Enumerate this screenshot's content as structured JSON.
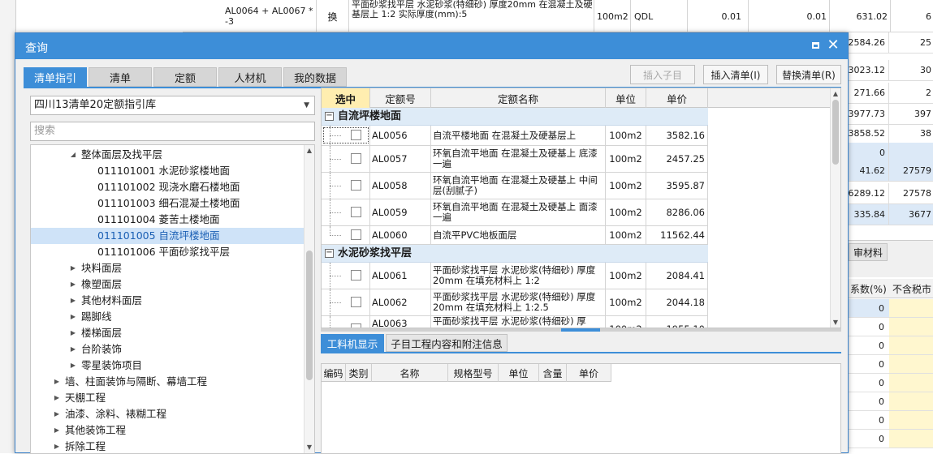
{
  "background": {
    "top_row": {
      "code": "AL0064 + AL0067 * -3",
      "type": "换",
      "desc": "平面砂浆找平层 水泥砂浆(特细砂) 厚度20mm 在混凝土及硬基层上 1:2  实际厚度(mm):5",
      "unit": "100m2",
      "qty_expr": "QDL",
      "qty1": "0.01",
      "qty2": "0.01",
      "price": "631.02",
      "extra": "6"
    },
    "right_values": [
      {
        "a": "2584.26",
        "b": "25"
      },
      {
        "a": "3023.12",
        "b": "30"
      },
      {
        "a": "271.66",
        "b": "2"
      },
      {
        "a": "3977.73",
        "b": "397"
      },
      {
        "a": "3858.52",
        "b": "38"
      },
      {
        "a": "0",
        "b": ""
      },
      {
        "a": "41.62",
        "b": "27579"
      },
      {
        "a": "6289.12",
        "b": "27578"
      },
      {
        "a": "335.84",
        "b": "3677"
      }
    ],
    "right_tab": "审材料",
    "right_header_a": "系数(%)",
    "right_header_b": "不含税市",
    "right_zero_rows": [
      "0",
      "0",
      "0",
      "0",
      "0",
      "0",
      "0",
      "0"
    ]
  },
  "dialog": {
    "title": "查询",
    "tabs": [
      "清单指引",
      "清单",
      "定额",
      "人材机",
      "我的数据"
    ],
    "buttons": {
      "insert_sub": "插入子目",
      "insert_list": "插入清单(I)",
      "replace_list": "替换清单(R)"
    },
    "library": "四川13清单20定额指引库",
    "search_placeholder": "搜索",
    "tree": [
      {
        "label": "整体面层及找平层",
        "expanded": true
      },
      {
        "label": "011101001  水泥砂浆楼地面"
      },
      {
        "label": "011101002  现浇水磨石楼地面"
      },
      {
        "label": "011101003  细石混凝土楼地面"
      },
      {
        "label": "011101004  菱苦土楼地面"
      },
      {
        "label": "011101005  自流坪楼地面"
      },
      {
        "label": "011101006  平面砂浆找平层"
      },
      {
        "label": "块料面层"
      },
      {
        "label": "橡塑面层"
      },
      {
        "label": "其他材料面层"
      },
      {
        "label": "踢脚线"
      },
      {
        "label": "楼梯面层"
      },
      {
        "label": "台阶装饰"
      },
      {
        "label": "零星装饰项目"
      },
      {
        "label": "墙、柱面装饰与隔断、幕墙工程"
      },
      {
        "label": "天棚工程"
      },
      {
        "label": "油漆、涂料、裱糊工程"
      },
      {
        "label": "其他装饰工程"
      },
      {
        "label": "拆除工程"
      }
    ],
    "grid": {
      "headers": [
        "选中",
        "定额号",
        "定额名称",
        "单位",
        "单价"
      ],
      "group1": "自流坪楼地面",
      "group1_rows": [
        {
          "code": "AL0056",
          "name": "自流平楼地面 在混凝土及硬基层上",
          "unit": "100m2",
          "price": "3582.16"
        },
        {
          "code": "AL0057",
          "name": "环氧自流平地面 在混凝土及硬基上 底漆一遍",
          "unit": "100m2",
          "price": "2457.25"
        },
        {
          "code": "AL0058",
          "name": "环氧自流平地面 在混凝土及硬基上 中间层(刮腻子)",
          "unit": "100m2",
          "price": "3595.87"
        },
        {
          "code": "AL0059",
          "name": "环氧自流平地面 在混凝土及硬基上 面漆一遍",
          "unit": "100m2",
          "price": "8286.06"
        },
        {
          "code": "AL0060",
          "name": "自流平PVC地板面层",
          "unit": "100m2",
          "price": "11562.44"
        }
      ],
      "group2": "水泥砂浆找平层",
      "group2_rows": [
        {
          "code": "AL0061",
          "name": "平面砂浆找平层 水泥砂浆(特细砂) 厚度20mm 在填充材料上 1:2",
          "unit": "100m2",
          "price": "2084.41"
        },
        {
          "code": "AL0062",
          "name": "平面砂浆找平层 水泥砂浆(特细砂) 厚度20mm 在填充材料上 1:2.5",
          "unit": "100m2",
          "price": "2044.18"
        },
        {
          "code": "AL0063",
          "name": "平面砂浆找平层 水泥砂浆(特细砂) 厚",
          "unit": "100m2",
          "price": "1955.10"
        }
      ]
    },
    "bottom_tabs": [
      "工料机显示",
      "子目工程内容和附注信息"
    ],
    "material_headers": [
      "编码",
      "类别",
      "名称",
      "规格型号",
      "单位",
      "含量",
      "单价"
    ]
  }
}
